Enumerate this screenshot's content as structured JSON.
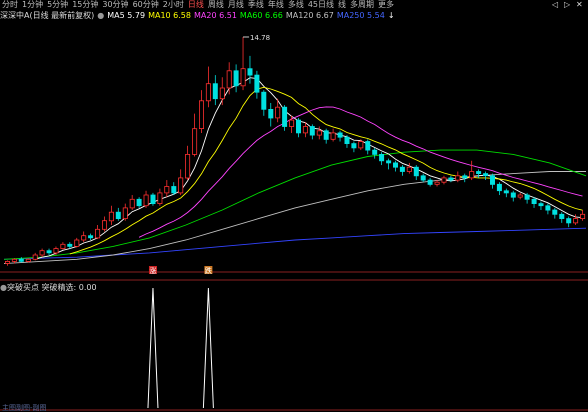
{
  "toolbar": {
    "periods": [
      "分时",
      "1分钟",
      "5分钟",
      "15分钟",
      "30分钟",
      "60分钟",
      "2小时"
    ],
    "active": "日线",
    "periods2": [
      "日线",
      "周线",
      "月线",
      "季线",
      "年线",
      "多线",
      "45日线",
      "线"
    ],
    "multi_period_label": "多周期",
    "more_label": "更多",
    "window_icons": [
      "◁",
      "▷",
      "✕"
    ]
  },
  "legend": {
    "title": "深深中A(日线 最新前复权)",
    "items": [
      {
        "label": "MA5",
        "value": "5.79",
        "color": "#ffffff"
      },
      {
        "label": "MA10",
        "value": "6.58",
        "color": "#ffff00"
      },
      {
        "label": "MA20",
        "value": "6.51",
        "color": "#ff44ff"
      },
      {
        "label": "MA60",
        "value": "6.66",
        "color": "#00ff00"
      },
      {
        "label": "MA120",
        "value": "6.67",
        "color": "#c0c0c0"
      },
      {
        "label": "MA250",
        "value": "5.54",
        "color": "#4466ff"
      }
    ]
  },
  "sub_legend": {
    "title": "突破买点",
    "label": "突破精选:",
    "value": "0.00"
  },
  "footer_label": "主图副图-副图",
  "chart_data": {
    "type": "candlestick",
    "high_label": "14.78",
    "signal_markers": [
      "涨",
      "跌"
    ],
    "candles": [
      [
        4.2,
        4.3,
        4.1,
        4.35
      ],
      [
        4.3,
        4.4,
        4.2,
        4.45
      ],
      [
        4.4,
        4.3,
        4.25,
        4.5
      ],
      [
        4.3,
        4.4,
        4.25,
        4.45
      ],
      [
        4.4,
        4.6,
        4.35,
        4.7
      ],
      [
        4.6,
        4.8,
        4.5,
        4.9
      ],
      [
        4.8,
        4.7,
        4.6,
        4.9
      ],
      [
        4.7,
        4.9,
        4.6,
        5.0
      ],
      [
        4.9,
        5.1,
        4.85,
        5.2
      ],
      [
        5.1,
        5.0,
        4.9,
        5.2
      ],
      [
        5.0,
        5.3,
        4.95,
        5.4
      ],
      [
        5.3,
        5.5,
        5.2,
        5.7
      ],
      [
        5.5,
        5.4,
        5.3,
        5.6
      ],
      [
        5.4,
        5.8,
        5.35,
        6.0
      ],
      [
        5.8,
        6.2,
        5.7,
        6.4
      ],
      [
        6.2,
        6.6,
        6.0,
        6.9
      ],
      [
        6.6,
        6.3,
        6.2,
        6.8
      ],
      [
        6.3,
        6.8,
        6.2,
        7.0
      ],
      [
        6.8,
        7.2,
        6.7,
        7.4
      ],
      [
        7.2,
        6.9,
        6.8,
        7.3
      ],
      [
        6.9,
        7.4,
        6.8,
        7.6
      ],
      [
        7.4,
        7.0,
        6.9,
        7.5
      ],
      [
        7.0,
        7.5,
        6.9,
        7.7
      ],
      [
        7.5,
        7.8,
        7.3,
        8.1
      ],
      [
        7.8,
        7.5,
        7.4,
        8.0
      ],
      [
        7.5,
        8.2,
        7.4,
        8.6
      ],
      [
        8.2,
        9.3,
        8.1,
        9.7
      ],
      [
        9.3,
        10.5,
        9.2,
        11.2
      ],
      [
        10.5,
        11.8,
        10.3,
        12.3
      ],
      [
        11.8,
        12.6,
        11.5,
        13.4
      ],
      [
        12.6,
        11.9,
        11.6,
        13.0
      ],
      [
        11.9,
        12.4,
        11.6,
        12.9
      ],
      [
        12.4,
        13.2,
        12.1,
        13.6
      ],
      [
        13.2,
        12.5,
        12.2,
        13.5
      ],
      [
        12.5,
        13.3,
        12.3,
        14.78
      ],
      [
        13.3,
        13.0,
        12.6,
        13.9
      ],
      [
        13.0,
        12.2,
        11.9,
        13.2
      ],
      [
        12.2,
        11.4,
        11.1,
        12.3
      ],
      [
        11.4,
        11.0,
        10.6,
        11.7
      ],
      [
        11.0,
        11.5,
        10.8,
        11.9
      ],
      [
        11.5,
        10.6,
        10.4,
        11.6
      ],
      [
        10.6,
        10.9,
        10.3,
        11.1
      ],
      [
        10.9,
        10.3,
        10.1,
        11.0
      ],
      [
        10.3,
        10.6,
        10.1,
        10.8
      ],
      [
        10.6,
        10.2,
        10.0,
        10.7
      ],
      [
        10.2,
        10.4,
        10.0,
        10.6
      ],
      [
        10.4,
        10.0,
        9.8,
        10.5
      ],
      [
        10.0,
        10.3,
        9.9,
        10.5
      ],
      [
        10.3,
        10.1,
        9.9,
        10.4
      ],
      [
        10.1,
        9.8,
        9.6,
        10.2
      ],
      [
        9.8,
        9.6,
        9.4,
        9.9
      ],
      [
        9.6,
        9.9,
        9.5,
        10.0
      ],
      [
        9.9,
        9.5,
        9.3,
        10.0
      ],
      [
        9.5,
        9.3,
        9.1,
        9.6
      ],
      [
        9.3,
        9.0,
        8.8,
        9.4
      ],
      [
        9.0,
        8.9,
        8.6,
        9.1
      ],
      [
        8.9,
        8.7,
        8.5,
        9.0
      ],
      [
        8.7,
        8.5,
        8.3,
        8.8
      ],
      [
        8.5,
        8.7,
        8.4,
        8.9
      ],
      [
        8.7,
        8.3,
        8.1,
        8.8
      ],
      [
        8.3,
        8.1,
        8.0,
        8.4
      ],
      [
        8.1,
        7.9,
        7.8,
        8.2
      ],
      [
        7.9,
        8.0,
        7.8,
        8.1
      ],
      [
        8.0,
        8.2,
        7.9,
        8.3
      ],
      [
        8.2,
        8.1,
        8.0,
        8.3
      ],
      [
        8.1,
        8.3,
        8.0,
        8.5
      ],
      [
        8.3,
        8.2,
        8.0,
        8.4
      ],
      [
        8.2,
        8.5,
        8.1,
        9.0
      ],
      [
        8.5,
        8.4,
        8.2,
        8.6
      ],
      [
        8.4,
        8.3,
        8.1,
        8.5
      ],
      [
        8.3,
        7.9,
        7.7,
        8.4
      ],
      [
        7.9,
        7.6,
        7.4,
        8.0
      ],
      [
        7.6,
        7.5,
        7.3,
        7.7
      ],
      [
        7.5,
        7.3,
        7.1,
        7.6
      ],
      [
        7.3,
        7.4,
        7.2,
        7.5
      ],
      [
        7.4,
        7.2,
        7.0,
        7.5
      ],
      [
        7.2,
        7.0,
        6.8,
        7.3
      ],
      [
        7.0,
        6.9,
        6.7,
        7.1
      ],
      [
        6.9,
        6.7,
        6.5,
        7.0
      ],
      [
        6.7,
        6.5,
        6.3,
        6.8
      ],
      [
        6.5,
        6.3,
        6.1,
        6.6
      ],
      [
        6.3,
        6.1,
        5.9,
        6.4
      ],
      [
        6.1,
        6.3,
        6.0,
        6.5
      ],
      [
        6.3,
        6.5,
        6.2,
        6.7
      ]
    ],
    "ma_lines": [
      {
        "name": "MA5",
        "color": "#ffffff",
        "period": 5
      },
      {
        "name": "MA10",
        "color": "#ffff00",
        "period": 10
      },
      {
        "name": "MA20",
        "color": "#ff44ff",
        "period": 20
      }
    ],
    "ma60": {
      "color": "#00dd00",
      "values": [
        4.4,
        4.5,
        4.7,
        5.0,
        5.4,
        6.0,
        6.7,
        7.5,
        8.2,
        8.8,
        9.2,
        9.4,
        9.5,
        9.5,
        9.3,
        8.9,
        8.3
      ]
    },
    "ma120": {
      "color": "#c0c0c0",
      "values": [
        4.2,
        4.3,
        4.4,
        4.6,
        4.9,
        5.3,
        5.8,
        6.3,
        6.8,
        7.2,
        7.6,
        7.9,
        8.1,
        8.3,
        8.4,
        8.5,
        8.5
      ]
    },
    "ma250": {
      "color": "#3344ff",
      "values": [
        4.4,
        4.45,
        4.5,
        4.6,
        4.7,
        4.85,
        5.0,
        5.15,
        5.3,
        5.4,
        5.5,
        5.6,
        5.65,
        5.7,
        5.75,
        5.8,
        5.85
      ]
    },
    "ylim": [
      3.9,
      15.2
    ],
    "sub_chart": {
      "type": "spike",
      "spike_candles": [
        21,
        29
      ],
      "ylim": [
        0,
        1
      ]
    }
  }
}
